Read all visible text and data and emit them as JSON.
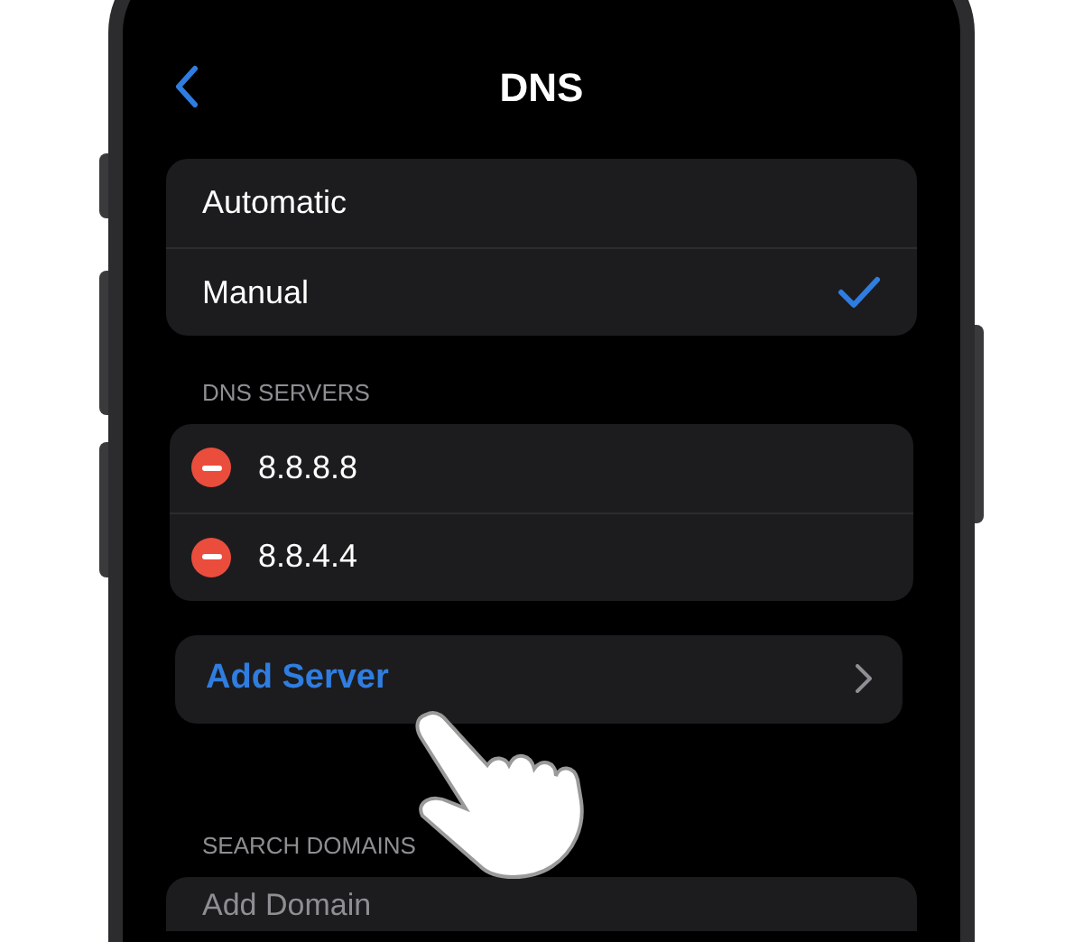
{
  "nav": {
    "title": "DNS"
  },
  "mode_options": [
    {
      "label": "Automatic",
      "selected": false
    },
    {
      "label": "Manual",
      "selected": true
    }
  ],
  "dns_servers": {
    "header": "DNS SERVERS",
    "items": [
      {
        "address": "8.8.8.8"
      },
      {
        "address": "8.8.4.4"
      }
    ]
  },
  "add_server": {
    "label": "Add Server"
  },
  "search_domains": {
    "header": "SEARCH DOMAINS",
    "add_label": "Add Domain"
  }
}
